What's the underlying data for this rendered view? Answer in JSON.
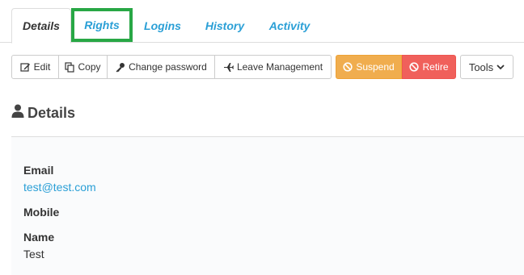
{
  "tabs": [
    {
      "label": "Details"
    },
    {
      "label": "Rights"
    },
    {
      "label": "Logins"
    },
    {
      "label": "History"
    },
    {
      "label": "Activity"
    }
  ],
  "toolbar": {
    "edit_label": "Edit",
    "copy_label": "Copy",
    "change_password_label": "Change password",
    "leave_management_label": "Leave Management",
    "suspend_label": "Suspend",
    "retire_label": "Retire",
    "tools_label": "Tools"
  },
  "section": {
    "title": "Details"
  },
  "fields": {
    "email_label": "Email",
    "email_value": "test@test.com",
    "mobile_label": "Mobile",
    "name_label": "Name",
    "name_value": "Test"
  },
  "colors": {
    "link": "#2a9fd6",
    "suspend": "#f0ad4e",
    "retire": "#f0605b",
    "highlight": "#28a745"
  },
  "icons": {
    "edit": "edit-icon",
    "copy": "copy-icon",
    "change_password": "key-icon",
    "leave_management": "plane-icon",
    "suspend": "ban-icon",
    "retire": "ban-icon",
    "tools": "chevron-down-icon",
    "section": "user-icon"
  }
}
